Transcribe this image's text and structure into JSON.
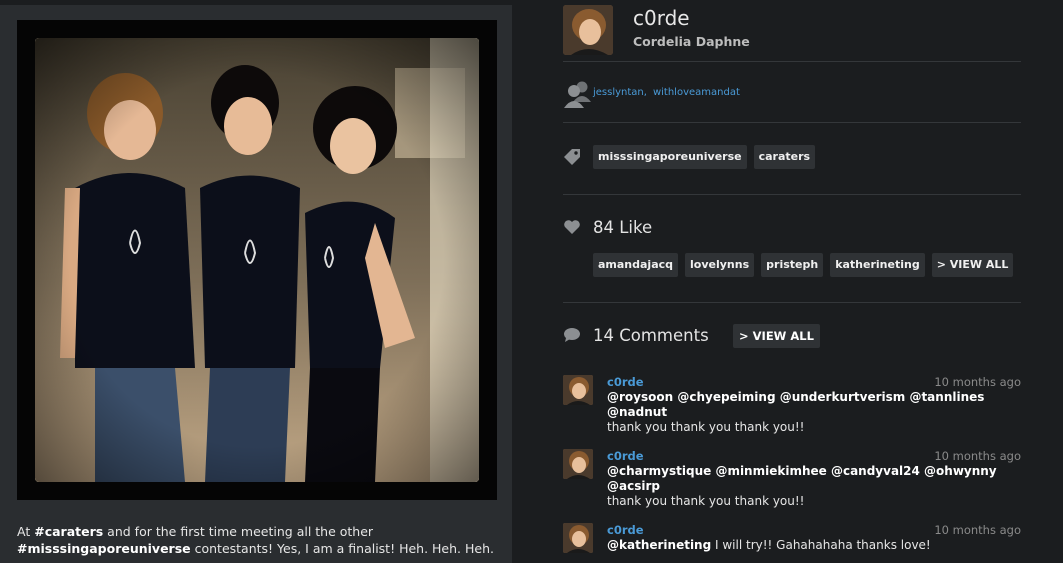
{
  "post": {
    "caption_parts": [
      {
        "text": "At ",
        "bold": false
      },
      {
        "text": "#caraters",
        "bold": true
      },
      {
        "text": " and for the first time meeting all the other ",
        "bold": false
      },
      {
        "text": "#misssingaporeuniverse",
        "bold": true
      },
      {
        "text": " contestants! Yes, I am a finalist! Heh. Heh. Heh.",
        "bold": false
      }
    ]
  },
  "author": {
    "username": "c0rde",
    "full_name": "Cordelia Daphne"
  },
  "tagged_users": [
    "jesslyntan,",
    "withloveamandat"
  ],
  "tags": [
    "misssingaporeuniverse",
    "caraters"
  ],
  "likes": {
    "count_label": "84 Like",
    "users": [
      "amandajacq",
      "lovelynns",
      "pristeph",
      "katherineting"
    ],
    "view_all_label": "> VIEW ALL"
  },
  "comments": {
    "count_label": "14 Comments",
    "view_all_label": "> VIEW ALL",
    "items": [
      {
        "user": "c0rde",
        "time": "10 months ago",
        "mentions": "@roysoon @chyepeiming @underkurtverism @tannlines @nadnut",
        "text": "thank you thank you thank you!!"
      },
      {
        "user": "c0rde",
        "time": "10 months ago",
        "mentions": "@charmystique @minmiekimhee @candyval24 @ohwynny @acsirp",
        "text": "thank you thank you thank you!!"
      },
      {
        "user": "c0rde",
        "time": "10 months ago",
        "mentions": "@katherineting",
        "text": " I will try!! Gahahahaha thanks love!"
      }
    ]
  },
  "colors": {
    "background": "#1b1d1f",
    "panel": "#2a2d30",
    "chip": "#2f3235",
    "link": "#4a9ad6",
    "icon": "#8c8f92"
  },
  "icons": [
    "tagged-users-icon",
    "tag-icon",
    "heart-icon",
    "comment-bubble-icon"
  ]
}
